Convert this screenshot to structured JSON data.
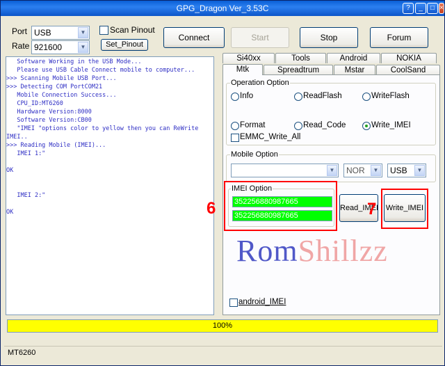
{
  "window": {
    "title": "GPG_Dragon  Ver_3.53C",
    "buttons": [
      "?",
      "_",
      "□",
      "×"
    ]
  },
  "connection": {
    "port_label": "Port",
    "port_value": "USB",
    "rate_label": "Rate",
    "rate_value": "921600",
    "scan_pinout_label": "Scan Pinout",
    "set_pinout_label": "Set_Pinout"
  },
  "toolbar": {
    "connect": "Connect",
    "start": "Start",
    "stop": "Stop",
    "forum": "Forum"
  },
  "log": [
    {
      "prefix": "   ",
      "text": "Software Working in the USB Mode..."
    },
    {
      "prefix": "   ",
      "text": "Please use USB Cable Connect mobile to computer..."
    },
    {
      "prefix": ">>>",
      "text": " Scanning Mobile USB Port..."
    },
    {
      "prefix": ">>>",
      "text": " Detecting COM PortCOM21"
    },
    {
      "prefix": "   ",
      "text": "Mobile Connection Success..."
    },
    {
      "prefix": "   ",
      "text": "CPU_ID:MT6260"
    },
    {
      "prefix": "   ",
      "text": "Hardware Version:8000"
    },
    {
      "prefix": "   ",
      "text": "Software Version:CB00"
    },
    {
      "prefix": "   ",
      "text": "\"IMEI \"options color to yellow then you can ReWrite"
    },
    {
      "prefix": "",
      "text": "IMEI.."
    },
    {
      "prefix": ">>>",
      "text": " Reading Mobile (IMEI)..."
    },
    {
      "prefix": "   ",
      "text": "IMEI 1:\""
    },
    {
      "prefix": "",
      "text": ""
    },
    {
      "prefix": "",
      "text": "OK"
    },
    {
      "prefix": "",
      "text": ""
    },
    {
      "prefix": "",
      "text": ""
    },
    {
      "prefix": "   ",
      "text": "IMEI 2:\""
    },
    {
      "prefix": "",
      "text": ""
    },
    {
      "prefix": "",
      "text": "OK"
    }
  ],
  "tabs_row1": [
    "Si40xx",
    "Tools",
    "Android",
    "NOKIA"
  ],
  "tabs_row2": [
    "Mtk",
    "Spreadtrum",
    "Mstar",
    "CoolSand"
  ],
  "active_tab": "Mtk",
  "operation": {
    "title": "Operation Option",
    "info": "Info",
    "readflash": "ReadFlash",
    "writeflash": "WriteFlash",
    "format": "Format",
    "read_code": "Read_Code",
    "write_imei": "Write_IMEI",
    "selected": "Write_IMEI",
    "emmc": "EMMC_Write_All"
  },
  "mobile": {
    "title": "Mobile Option",
    "model_value": "",
    "flash_value": "NOR",
    "port_value": "USB"
  },
  "imei": {
    "title": "IMEI Option",
    "imei1": "352256880987665",
    "imei2": "352256880987665",
    "read_button": "Read_IMEI",
    "write_button": "Write_IMEI",
    "annotation_6": "6",
    "annotation_7": "7"
  },
  "watermark": {
    "part1": "Rom",
    "part2": "Shillzz"
  },
  "android_imei_label": "android_IMEI",
  "progress": {
    "value": 100,
    "text": "100%"
  },
  "status": {
    "chip": "MT6260"
  },
  "colors": {
    "imei_field": "#00ff00",
    "progress": "#ffff00",
    "annotation": "#ff0000",
    "log_text": "#2e2ec4"
  }
}
